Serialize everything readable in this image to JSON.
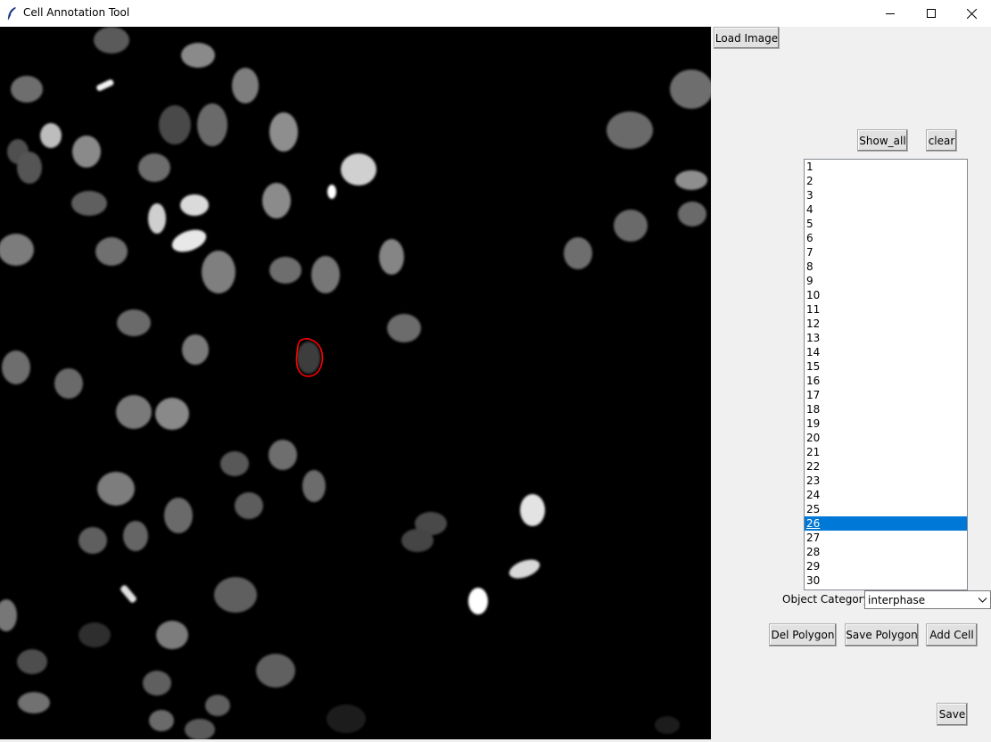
{
  "window": {
    "title": "Cell Annotation Tool",
    "controls": [
      "minimize-icon",
      "maximize-icon",
      "close-icon"
    ]
  },
  "canvas": {
    "description_icon": "microscopy-image",
    "highlight_color": "#ff0000"
  },
  "panel": {
    "load_image_label": "Load Image",
    "show_all_label": "Show_all",
    "clear_label": "clear",
    "list_items": [
      "1",
      "2",
      "3",
      "4",
      "5",
      "6",
      "7",
      "8",
      "9",
      "10",
      "11",
      "12",
      "13",
      "14",
      "15",
      "16",
      "17",
      "18",
      "19",
      "20",
      "21",
      "22",
      "23",
      "24",
      "25",
      "26",
      "27",
      "28",
      "29",
      "30"
    ],
    "selected_item": "26",
    "category_label": "Object Category:",
    "category_value": "interphase",
    "del_polygon_label": "Del Polygon",
    "save_polygon_label": "Save Polygon",
    "add_cell_label": "Add Cell",
    "save_label": "Save"
  },
  "colors": {
    "selection": "#0078d7",
    "panel_bg": "#f0f0f0",
    "canvas_bg": "#000000"
  }
}
